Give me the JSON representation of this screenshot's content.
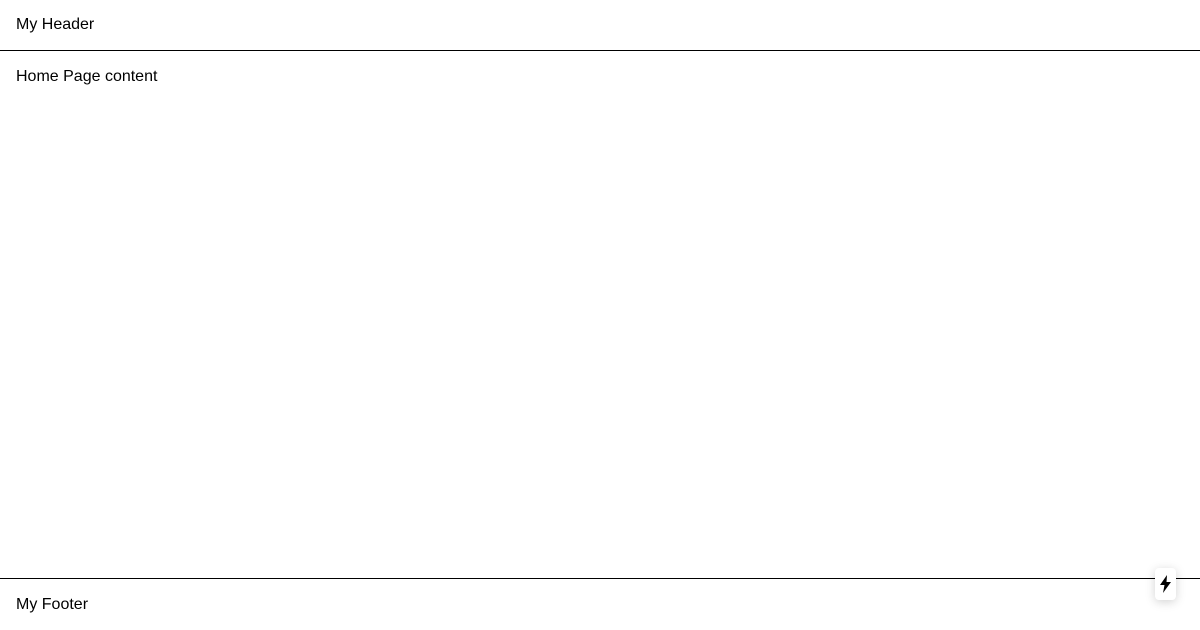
{
  "header": {
    "title": "My Header"
  },
  "main": {
    "content": "Home Page content"
  },
  "footer": {
    "text": "My Footer"
  },
  "dev_indicator": {
    "icon": "lightning-bolt-icon"
  }
}
